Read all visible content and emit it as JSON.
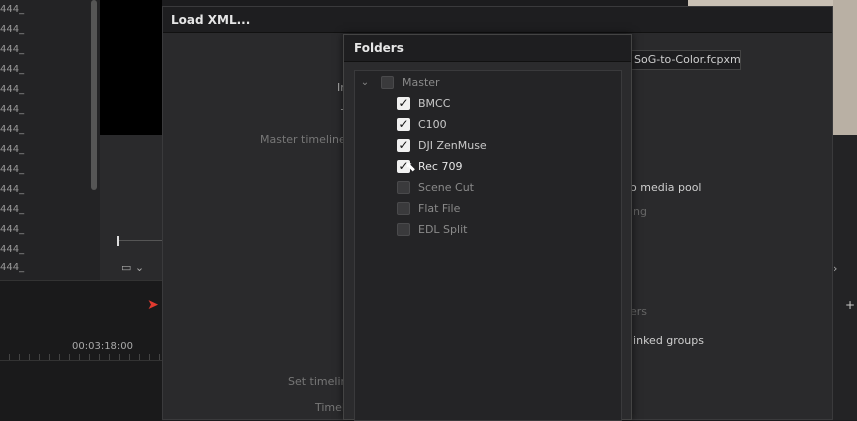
{
  "background": {
    "left_rows": [
      "444_",
      "444_",
      "444_",
      "444_",
      "444_",
      "444_",
      "444_",
      "444_",
      "444_",
      "444_",
      "444_",
      "444_",
      "444_",
      "444_"
    ],
    "timecode": "00:03:18:00"
  },
  "dialog": {
    "title": "Load XML...",
    "labels": {
      "partial1": "In",
      "partial2": "T",
      "master_timeline": "Master timeline s",
      "set_timeline": "Set timeline",
      "timeline": "Timel"
    },
    "file_value": "SoG-to-Color.fcpxml",
    "right_texts": {
      "media_pool": "o media pool",
      "ng": "ing",
      "ers": "ers",
      "linked": "linked groups"
    }
  },
  "folders": {
    "title": "Folders",
    "root": {
      "label": "Master",
      "checked": false
    },
    "items": [
      {
        "label": "BMCC",
        "checked": true
      },
      {
        "label": "C100",
        "checked": true
      },
      {
        "label": "DJI ZenMuse",
        "checked": true
      },
      {
        "label": "Rec 709",
        "checked": true
      },
      {
        "label": "Scene Cut",
        "checked": false
      },
      {
        "label": "Flat File",
        "checked": false
      },
      {
        "label": "EDL Split",
        "checked": false
      }
    ]
  },
  "colors": {
    "accent": "#e03a2f",
    "dialog_bg": "#2a2a2c",
    "title_bg": "#1e1e20"
  }
}
